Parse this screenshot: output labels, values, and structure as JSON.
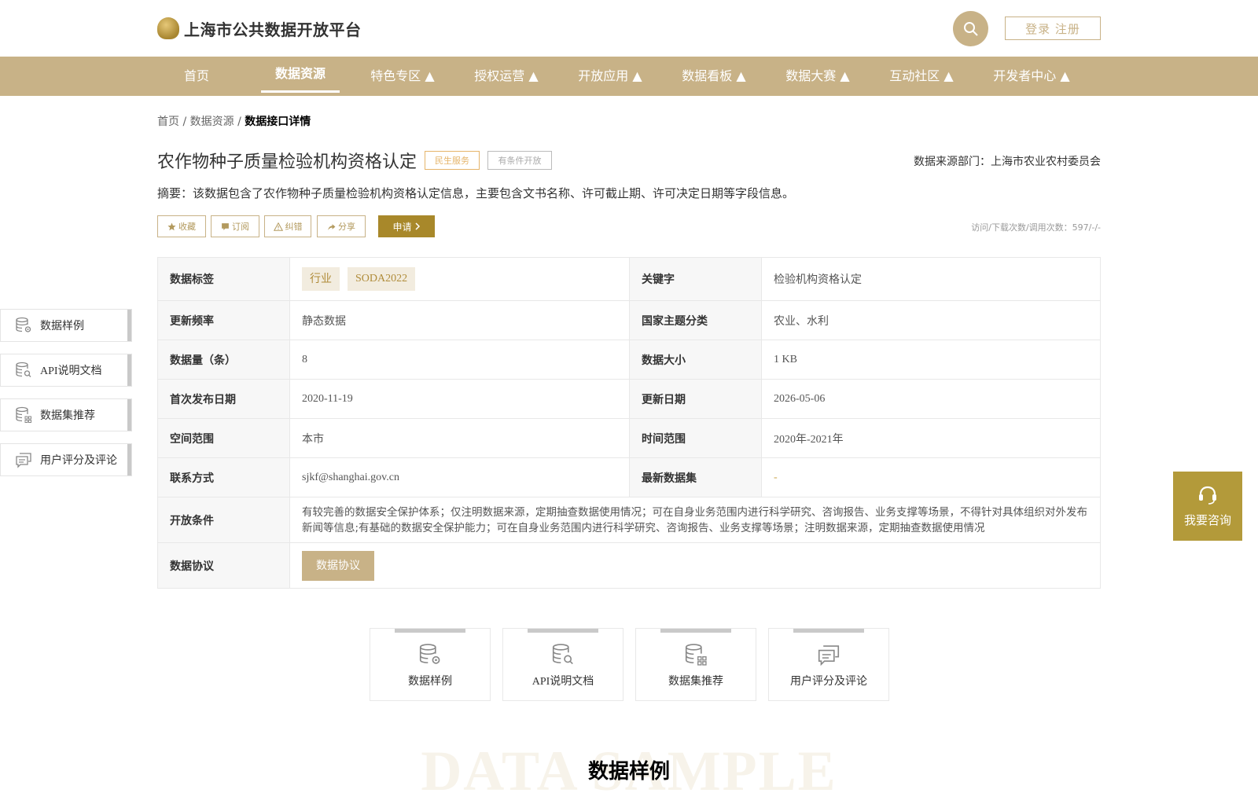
{
  "header": {
    "logo_text": "上海市公共数据开放平台",
    "auth_label": "登录 注册"
  },
  "nav": {
    "items": [
      {
        "label": "首页"
      },
      {
        "label": "数据资源"
      },
      {
        "label": "特色专区 ▲"
      },
      {
        "label": "授权运营 ▲"
      },
      {
        "label": "开放应用 ▲"
      },
      {
        "label": "数据看板 ▲"
      },
      {
        "label": "数据大赛 ▲"
      },
      {
        "label": "互动社区 ▲"
      },
      {
        "label": "开发者中心 ▲"
      }
    ],
    "active_index": 1
  },
  "breadcrumb": {
    "home": "首页",
    "sep": "/",
    "resources": "数据资源",
    "current": "数据接口详情"
  },
  "detail": {
    "title": "农作物种子质量检验机构资格认定",
    "tag_service": "民生服务",
    "tag_open": "有条件开放",
    "source": "数据来源部门：上海市农业农村委员会",
    "summary": "摘要：该数据包含了农作物种子质量检验机构资格认定信息，主要包含文书名称、许可截止期、许可决定日期等字段信息。",
    "stats": "访问/下载次数/调用次数：597/-/-"
  },
  "actions": {
    "favorite": "收藏",
    "subscribe": "订阅",
    "correct": "纠错",
    "share": "分享",
    "apply": "申请"
  },
  "table": {
    "tags_label": "数据标签",
    "tags": [
      "行业",
      "SODA2022"
    ],
    "keyword_label": "关键字",
    "keyword": "检验机构资格认定",
    "freq_label": "更新频率",
    "freq": "静态数据",
    "theme_label": "国家主题分类",
    "theme": "农业、水利",
    "count_label": "数据量（条）",
    "count": "8",
    "size_label": "数据大小",
    "size": "1 KB",
    "first_label": "首次发布日期",
    "first": "2020-11-19",
    "update_label": "更新日期",
    "update": "2026-05-06",
    "space_label": "空间范围",
    "space": "本市",
    "time_label": "时间范围",
    "time": "2020年-2021年",
    "contact_label": "联系方式",
    "contact": "sjkf@shanghai.gov.cn",
    "latest_label": "最新数据集",
    "latest": "-",
    "cond_label": "开放条件",
    "cond": "有较完善的数据安全保护体系；仅注明数据来源，定期抽查数据使用情况；可在自身业务范围内进行科学研究、咨询报告、业务支撑等场景，不得针对具体组织对外发布新闻等信息;有基础的数据安全保护能力；可在自身业务范围内进行科学研究、咨询报告、业务支撑等场景；注明数据来源，定期抽查数据使用情况",
    "proto_label": "数据协议",
    "proto_btn": "数据协议"
  },
  "side_nav": [
    {
      "label": "数据样例",
      "icon": "database-gear-icon"
    },
    {
      "label": "API说明文档",
      "icon": "database-search-icon"
    },
    {
      "label": "数据集推荐",
      "icon": "database-grid-icon"
    },
    {
      "label": "用户评分及评论",
      "icon": "comment-icon"
    }
  ],
  "consult": {
    "label": "我要咨询",
    "icon": "headset-icon"
  },
  "cards": [
    {
      "label": "数据样例",
      "icon": "database-gear-icon"
    },
    {
      "label": "API说明文档",
      "icon": "database-search-icon"
    },
    {
      "label": "数据集推荐",
      "icon": "database-grid-icon"
    },
    {
      "label": "用户评分及评论",
      "icon": "comment-icon"
    }
  ],
  "section": {
    "watermark": "DATA SAMPLE",
    "title": "数据样例"
  },
  "colors": {
    "gold": "#c8b287",
    "dark_gold": "#a8882a",
    "consult": "#b39a3a"
  }
}
